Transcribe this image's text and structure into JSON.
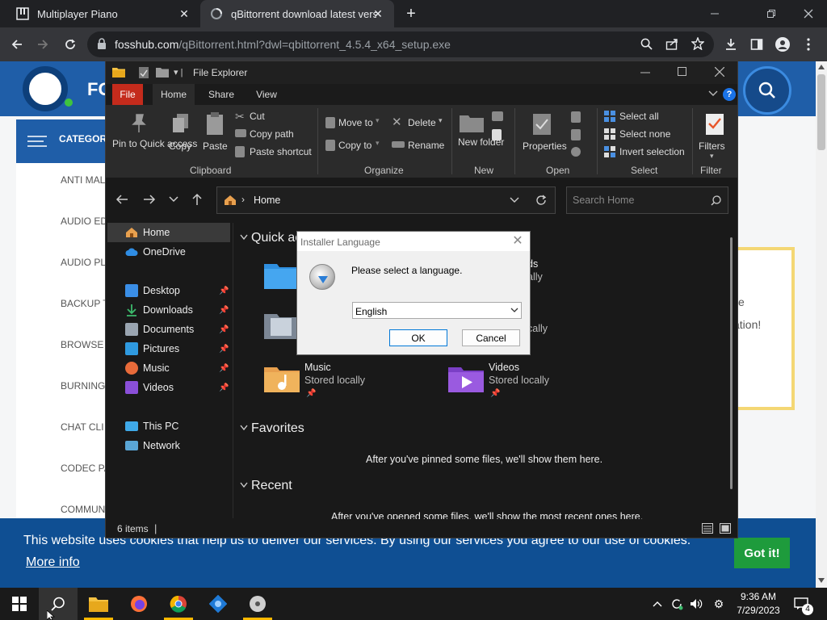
{
  "browser": {
    "tabs": [
      {
        "title": "Multiplayer Piano"
      },
      {
        "title": "qBittorrent download latest versi"
      }
    ],
    "url_host": "fosshub.com",
    "url_path": "/qBittorrent.html?dwl=qbittorrent_4.5.4_x64_setup.exe"
  },
  "site": {
    "logo_text": "FO",
    "categories_label": "CATEGORIES",
    "categories": [
      "ANTI MAL",
      "AUDIO ED",
      "AUDIO PL",
      "BACKUP T",
      "BROWSE",
      "BURNING",
      "CHAT CLI",
      "CODEC PA",
      "COMMUN"
    ],
    "promo_line1": "e",
    "promo_line2": "ation!"
  },
  "cookie": {
    "text": "This website uses cookies that help us to deliver our services. By using our services you agree to our use of cookies.",
    "more": "More info",
    "ok": "Got it!"
  },
  "explorer": {
    "title": "File Explorer",
    "tabs": {
      "file": "File",
      "home": "Home",
      "share": "Share",
      "view": "View"
    },
    "ribbon": {
      "pin": "Pin to Quick access",
      "copy": "Copy",
      "paste": "Paste",
      "cut": "Cut",
      "copy_path": "Copy path",
      "paste_shortcut": "Paste shortcut",
      "move_to": "Move to",
      "copy_to": "Copy to",
      "delete": "Delete",
      "rename": "Rename",
      "new_folder": "New folder",
      "properties": "Properties",
      "select_all": "Select all",
      "select_none": "Select none",
      "invert_selection": "Invert selection",
      "filters": "Filters",
      "groups": {
        "clipboard": "Clipboard",
        "organize": "Organize",
        "new": "New",
        "open": "Open",
        "select": "Select",
        "filter": "Filter"
      }
    },
    "address": "Home",
    "search_placeholder": "Search Home",
    "sidebar": {
      "home": "Home",
      "onedrive": "OneDrive",
      "desktop": "Desktop",
      "downloads": "Downloads",
      "documents": "Documents",
      "pictures": "Pictures",
      "music": "Music",
      "videos": "Videos",
      "thispc": "This PC",
      "network": "Network"
    },
    "quick_access": "Quick ac",
    "tile_peek1_a": "ds",
    "tile_peek1_b": "ally",
    "tile_peek2": "cally",
    "music_name": "Music",
    "music_sub": "Stored locally",
    "videos_name": "Videos",
    "videos_sub": "Stored locally",
    "favorites": "Favorites",
    "favorites_msg": "After you've pinned some files, we'll show them here.",
    "recent": "Recent",
    "recent_msg": "After you've opened some files, we'll show the most recent ones here.",
    "status": "6 items"
  },
  "dialog": {
    "title": "Installer Language",
    "message": "Please select a language.",
    "selected_language": "English",
    "ok": "OK",
    "cancel": "Cancel"
  },
  "taskbar": {
    "time": "9:36 AM",
    "date": "7/29/2023",
    "notif_count": "4"
  }
}
